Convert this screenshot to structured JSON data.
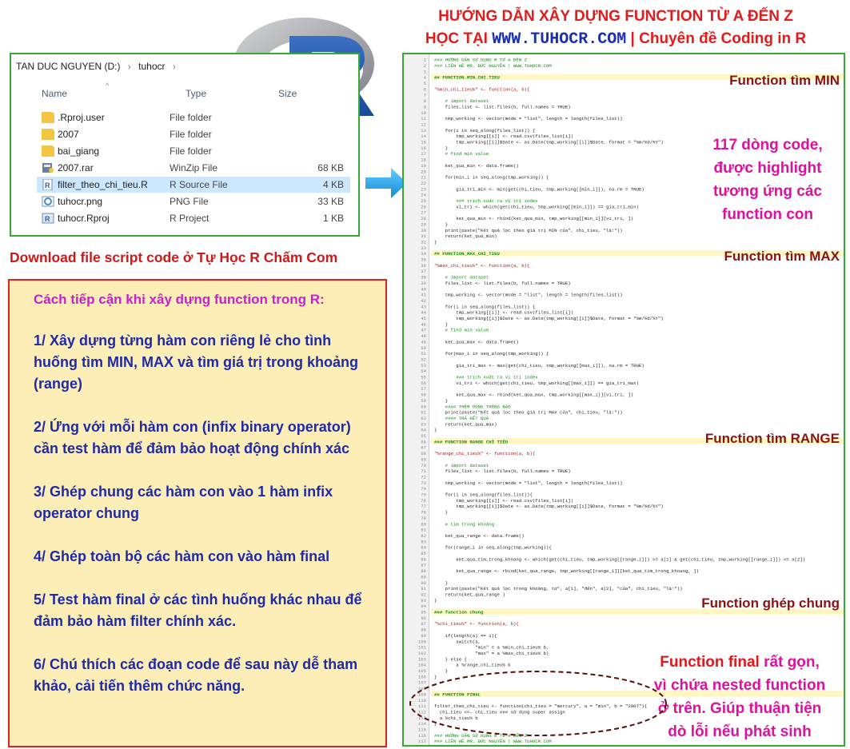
{
  "title": {
    "line1": "HƯỚNG DẪN XÂY DỰNG FUNCTION TỪ A ĐẾN Z",
    "line2_prefix": "HỌC TẠI",
    "line2_url": "WWW.TUHOCR.COM",
    "line2_suffix": "| Chuyên đề Coding in R"
  },
  "explorer": {
    "breadcrumb": [
      "TAN DUC NGUYEN (D:)",
      "tuhocr"
    ],
    "columns": [
      "Name",
      "Type",
      "Size"
    ],
    "files": [
      {
        "name": ".Rproj.user",
        "type": "File folder",
        "size": "",
        "icon": "folder-icon"
      },
      {
        "name": "2007",
        "type": "File folder",
        "size": "",
        "icon": "folder-icon"
      },
      {
        "name": "bai_giang",
        "type": "File folder",
        "size": "",
        "icon": "folder-icon"
      },
      {
        "name": "2007.rar",
        "type": "WinZip File",
        "size": "68 KB",
        "icon": "winzip-icon"
      },
      {
        "name": "filter_theo_chi_tieu.R",
        "type": "R Source File",
        "size": "4 KB",
        "icon": "r-source-icon"
      },
      {
        "name": "tuhocr.png",
        "type": "PNG File",
        "size": "33 KB",
        "icon": "image-file-icon"
      },
      {
        "name": "tuhocr.Rproj",
        "type": "R Project",
        "size": "1 KB",
        "icon": "r-project-icon"
      }
    ]
  },
  "download_text": "Download file script code ở Tự Học R Chấm Com",
  "approach": {
    "heading": "Cách tiếp cận khi xây dựng function trong R:",
    "steps": [
      "1/ Xây dựng từng hàm con riêng lẻ cho tình huống tìm MIN, MAX và tìm giá trị trong khoảng (range)",
      "2/ Ứng với mỗi hàm con (infix binary operator) cần test hàm để đảm bảo hoạt động chính xác",
      "3/ Ghép chung các hàm con vào 1 hàm infix operator chung",
      "4/ Ghép toàn bộ các hàm con vào hàm final",
      "5/ Test hàm final ở các tình huống khác nhau để đảm bảo hàm filter chính xác.",
      "6/ Chú thích các đoạn code để sau này dễ tham khảo, cải tiến thêm chức năng."
    ]
  },
  "annotations": {
    "min": "Function tìm MIN",
    "lines_note": [
      "117 dòng code,",
      "được highlight",
      "tương ứng các",
      "function con"
    ],
    "max": "Function tìm MAX",
    "range": "Function tìm RANGE",
    "merge": "Function ghép chung",
    "final": [
      {
        "text": "Function final",
        "color": "red"
      },
      {
        "text": " rất gọn,",
        "color": "magenta"
      },
      {
        "text": "\nvì chứa nested function",
        "color": "magenta"
      },
      {
        "text": "\nở trên. Giúp thuận tiện",
        "color": "magenta"
      },
      {
        "text": "\ndò lỗi nếu phát sinh",
        "color": "magenta"
      }
    ]
  },
  "code": {
    "line_count": 117,
    "lines": [
      {
        "n": 1,
        "t": "### HƯỚNG DẪN SỬ DỤNG R TỪ A ĐẾN Z",
        "c": "cm"
      },
      {
        "n": 2,
        "t": "### LIÊN HỆ MR. ĐỨC NGUYỄN | WWW.TUHOCR.COM",
        "c": "cm"
      },
      {
        "n": 3,
        "t": "",
        "c": ""
      },
      {
        "n": 4,
        "t": "## FUNCTION_MIN_CHI_TIEU",
        "c": "hd"
      },
      {
        "n": 5,
        "t": "",
        "c": ""
      },
      {
        "n": 6,
        "t": "\"%min_chi_tieu%\" <- function(a, b){",
        "c": "fn"
      },
      {
        "n": 7,
        "t": "",
        "c": ""
      },
      {
        "n": 8,
        "t": "    # import dataset",
        "c": "cm"
      },
      {
        "n": 9,
        "t": "    files_list <- list.files(b, full.names = TRUE)",
        "c": ""
      },
      {
        "n": 10,
        "t": "",
        "c": ""
      },
      {
        "n": 11,
        "t": "    tmp_working <- vector(mode = \"list\", length = length(files_list))",
        "c": ""
      },
      {
        "n": 12,
        "t": "",
        "c": ""
      },
      {
        "n": 13,
        "t": "    for(i in seq_along(files_list)) {",
        "c": ""
      },
      {
        "n": 14,
        "t": "        tmp_working[[i]] <- read.csv(files_list[i])",
        "c": ""
      },
      {
        "n": 15,
        "t": "        tmp_working[[i]]$Date <- as.Date(tmp_working[[i]]$Date, format = \"%m/%d/%Y\")",
        "c": ""
      },
      {
        "n": 16,
        "t": "    }",
        "c": ""
      },
      {
        "n": 17,
        "t": "    # find min value",
        "c": "cm"
      },
      {
        "n": 18,
        "t": "",
        "c": ""
      },
      {
        "n": 19,
        "t": "    ket_qua_min <- data.frame()",
        "c": ""
      },
      {
        "n": 20,
        "t": "",
        "c": ""
      },
      {
        "n": 21,
        "t": "    for(min_i in seq_along(tmp_working)) {",
        "c": ""
      },
      {
        "n": 22,
        "t": "",
        "c": ""
      },
      {
        "n": 23,
        "t": "        gia_tri_min <- min(get(chi_tieu, tmp_working[[min_i]]), na.rm = TRUE)",
        "c": ""
      },
      {
        "n": 24,
        "t": "",
        "c": ""
      },
      {
        "n": 25,
        "t": "        ### trích xuất ra vị trí index",
        "c": "cm"
      },
      {
        "n": 26,
        "t": "        vi_tri <- which(get(chi_tieu, tmp_working[[min_i]]) == gia_tri_min)",
        "c": ""
      },
      {
        "n": 27,
        "t": "",
        "c": ""
      },
      {
        "n": 28,
        "t": "        ket_qua_min <- rbind(ket_qua_min, tmp_working[[min_i]][vi_tri, ])",
        "c": ""
      },
      {
        "n": 29,
        "t": "    }",
        "c": ""
      },
      {
        "n": 30,
        "t": "    print(paste(\"Kết quả lọc theo giá trị MIN của\", chi_tieu, \"là:\"))",
        "c": ""
      },
      {
        "n": 31,
        "t": "    return(ket_qua_min)",
        "c": ""
      },
      {
        "n": 32,
        "t": "}",
        "c": ""
      },
      {
        "n": 33,
        "t": "",
        "c": ""
      },
      {
        "n": 34,
        "t": "## FUNCTION_MAX_CHI_TIEU",
        "c": "hd"
      },
      {
        "n": 35,
        "t": "",
        "c": ""
      },
      {
        "n": 36,
        "t": "\"%max_chi_tieu%\" <- function(a, b){",
        "c": "fn"
      },
      {
        "n": 37,
        "t": "",
        "c": ""
      },
      {
        "n": 38,
        "t": "    # import dataset",
        "c": "cm"
      },
      {
        "n": 39,
        "t": "    files_list <- list.files(b, full.names = TRUE)",
        "c": ""
      },
      {
        "n": 40,
        "t": "",
        "c": ""
      },
      {
        "n": 41,
        "t": "    tmp_working <- vector(mode = \"list\", length = length(files_list))",
        "c": ""
      },
      {
        "n": 42,
        "t": "",
        "c": ""
      },
      {
        "n": 43,
        "t": "    for(i in seq_along(files_list)) {",
        "c": ""
      },
      {
        "n": 44,
        "t": "        tmp_working[[i]] <- read.csv(files_list[i])",
        "c": ""
      },
      {
        "n": 45,
        "t": "        tmp_working[[i]]$Date <- as.Date(tmp_working[[i]]$Date, format = \"%m/%d/%Y\")",
        "c": ""
      },
      {
        "n": 46,
        "t": "    }",
        "c": ""
      },
      {
        "n": 47,
        "t": "    # find min value",
        "c": "cm"
      },
      {
        "n": 48,
        "t": "",
        "c": ""
      },
      {
        "n": 49,
        "t": "    ket_qua_max <- data.frame()",
        "c": ""
      },
      {
        "n": 50,
        "t": "",
        "c": ""
      },
      {
        "n": 51,
        "t": "    for(max_i in seq_along(tmp_working)) {",
        "c": ""
      },
      {
        "n": 52,
        "t": "",
        "c": ""
      },
      {
        "n": 53,
        "t": "        gia_tri_max <- max(get(chi_tieu, tmp_working[[max_i]]), na.rm = TRUE)",
        "c": ""
      },
      {
        "n": 54,
        "t": "",
        "c": ""
      },
      {
        "n": 55,
        "t": "        ### trích xuất ra vị trí index",
        "c": "cm"
      },
      {
        "n": 56,
        "t": "        vi_tri <- which(get(chi_tieu, tmp_working[[max_i]]) == gia_tri_max)",
        "c": ""
      },
      {
        "n": 57,
        "t": "",
        "c": ""
      },
      {
        "n": 58,
        "t": "        ket_qua_max <- rbind(ket_qua_max, tmp_working[[max_i]][vi_tri, ])",
        "c": ""
      },
      {
        "n": 59,
        "t": "    }",
        "c": ""
      },
      {
        "n": 60,
        "t": "    #### THÊM DÒNG THÔNG BÁO",
        "c": "cm"
      },
      {
        "n": 61,
        "t": "    print(paste(\"Kết quả lọc theo giá trị MAX của\", chi_tieu, \"là:\"))",
        "c": ""
      },
      {
        "n": 62,
        "t": "    #### TRẢ KẾT QUẢ",
        "c": "cm"
      },
      {
        "n": 63,
        "t": "    return(ket_qua_max)",
        "c": ""
      },
      {
        "n": 64,
        "t": "}",
        "c": ""
      },
      {
        "n": 65,
        "t": "",
        "c": ""
      },
      {
        "n": 66,
        "t": "### FUNCTION RANGE CHỈ TIÊU",
        "c": "hd"
      },
      {
        "n": 67,
        "t": "",
        "c": ""
      },
      {
        "n": 68,
        "t": "\"%range_chi_tieu%\" <- function(a, b){",
        "c": "fn"
      },
      {
        "n": 69,
        "t": "",
        "c": ""
      },
      {
        "n": 70,
        "t": "    # import dataset",
        "c": "cm"
      },
      {
        "n": 71,
        "t": "    files_list <- list.files(b, full.names = TRUE)",
        "c": ""
      },
      {
        "n": 72,
        "t": "",
        "c": ""
      },
      {
        "n": 73,
        "t": "    tmp_working <- vector(mode = \"list\", length = length(files_list))",
        "c": ""
      },
      {
        "n": 74,
        "t": "",
        "c": ""
      },
      {
        "n": 75,
        "t": "    for(i in seq_along(files_list)){",
        "c": ""
      },
      {
        "n": 76,
        "t": "        tmp_working[[i]] <- read.csv(files_list[i])",
        "c": ""
      },
      {
        "n": 77,
        "t": "        tmp_working[[i]]$Date <- as.Date(tmp_working[[i]]$Date, format = \"%m/%d/%Y\")",
        "c": ""
      },
      {
        "n": 78,
        "t": "    }",
        "c": ""
      },
      {
        "n": 79,
        "t": "",
        "c": ""
      },
      {
        "n": 80,
        "t": "    # tìm trong khoảng",
        "c": "cm"
      },
      {
        "n": 81,
        "t": "",
        "c": ""
      },
      {
        "n": 82,
        "t": "    ket_qua_range <- data.frame()",
        "c": ""
      },
      {
        "n": 83,
        "t": "",
        "c": ""
      },
      {
        "n": 84,
        "t": "    for(range_i in seq_along(tmp_working)){",
        "c": ""
      },
      {
        "n": 85,
        "t": "",
        "c": ""
      },
      {
        "n": 86,
        "t": "        ket_qua_tim_trong_khoang <- which(get(chi_tieu, tmp_working[[range_i]]) >= a[1] & get(chi_tieu, tmp_working[[range_i]]) <= a[2])",
        "c": ""
      },
      {
        "n": 87,
        "t": "",
        "c": ""
      },
      {
        "n": 88,
        "t": "        ket_qua_range <- rbind(ket_qua_range, tmp_working[[range_i]][ket_qua_tim_trong_khoang, ])",
        "c": ""
      },
      {
        "n": 89,
        "t": "",
        "c": ""
      },
      {
        "n": 90,
        "t": "    }",
        "c": ""
      },
      {
        "n": 91,
        "t": "    print(paste(\"Kết quả lọc trong khoảng, từ\", a[1], \"đến\", a[2], \"của\", chi_tieu, \"là:\"))",
        "c": ""
      },
      {
        "n": 92,
        "t": "    return(ket_qua_range )",
        "c": ""
      },
      {
        "n": 93,
        "t": "}",
        "c": ""
      },
      {
        "n": 94,
        "t": "",
        "c": ""
      },
      {
        "n": 95,
        "t": "### function chung",
        "c": "hd"
      },
      {
        "n": 96,
        "t": "",
        "c": ""
      },
      {
        "n": 97,
        "t": "\"%chi_tieu%\" <- function(a, b){",
        "c": "fn"
      },
      {
        "n": 98,
        "t": "",
        "c": ""
      },
      {
        "n": 99,
        "t": "    if(length(a) == 1){",
        "c": ""
      },
      {
        "n": 100,
        "t": "        switch(a,",
        "c": ""
      },
      {
        "n": 101,
        "t": "               \"min\" = a %min_chi_tieu% b,",
        "c": ""
      },
      {
        "n": 102,
        "t": "               \"max\" = a %max_chi_tieu% b)",
        "c": ""
      },
      {
        "n": 103,
        "t": "    } else {",
        "c": ""
      },
      {
        "n": 104,
        "t": "        a %range_chi_tieu% b",
        "c": ""
      },
      {
        "n": 105,
        "t": "    }",
        "c": ""
      },
      {
        "n": 106,
        "t": "}",
        "c": ""
      },
      {
        "n": 107,
        "t": "",
        "c": ""
      },
      {
        "n": 108,
        "t": "",
        "c": ""
      },
      {
        "n": 109,
        "t": "## FUNCTION FINAL",
        "c": "hd"
      },
      {
        "n": 110,
        "t": "",
        "c": ""
      },
      {
        "n": 111,
        "t": "filter_theo_chi_tieu <- function(chi_tieu = \"mercury\", a = \"min\", b = \"2007\"){",
        "c": ""
      },
      {
        "n": 112,
        "t": "  chi_tieu <<- chi_tieu ### sử dụng super assign",
        "c": ""
      },
      {
        "n": 113,
        "t": "  a %chi_tieu% b",
        "c": ""
      },
      {
        "n": 114,
        "t": "}",
        "c": ""
      },
      {
        "n": 115,
        "t": "",
        "c": ""
      },
      {
        "n": 116,
        "t": "### HƯỚNG DẪN SỬ DỤNG R TỪ A ĐẾN Z",
        "c": "cm"
      },
      {
        "n": 117,
        "t": "### LIÊN HỆ MR. ĐỨC NGUYỄN | WWW.TUHOCR.COM",
        "c": "cm"
      }
    ]
  },
  "colors": {
    "title_red": "#e31b1b",
    "url_blue": "#1a2fb3",
    "frame_green": "#36a836",
    "box_red": "#e0221c",
    "box_fill": "#fdeeb8",
    "step_blue": "#1f2aa8",
    "heading_magenta": "#c91fcf",
    "annotation_darkred": "#8b1212",
    "highlight_yellow": "#fff7c2",
    "code_keyword": "#0000ff",
    "code_comment": "#009900",
    "code_string": "#a31515"
  }
}
